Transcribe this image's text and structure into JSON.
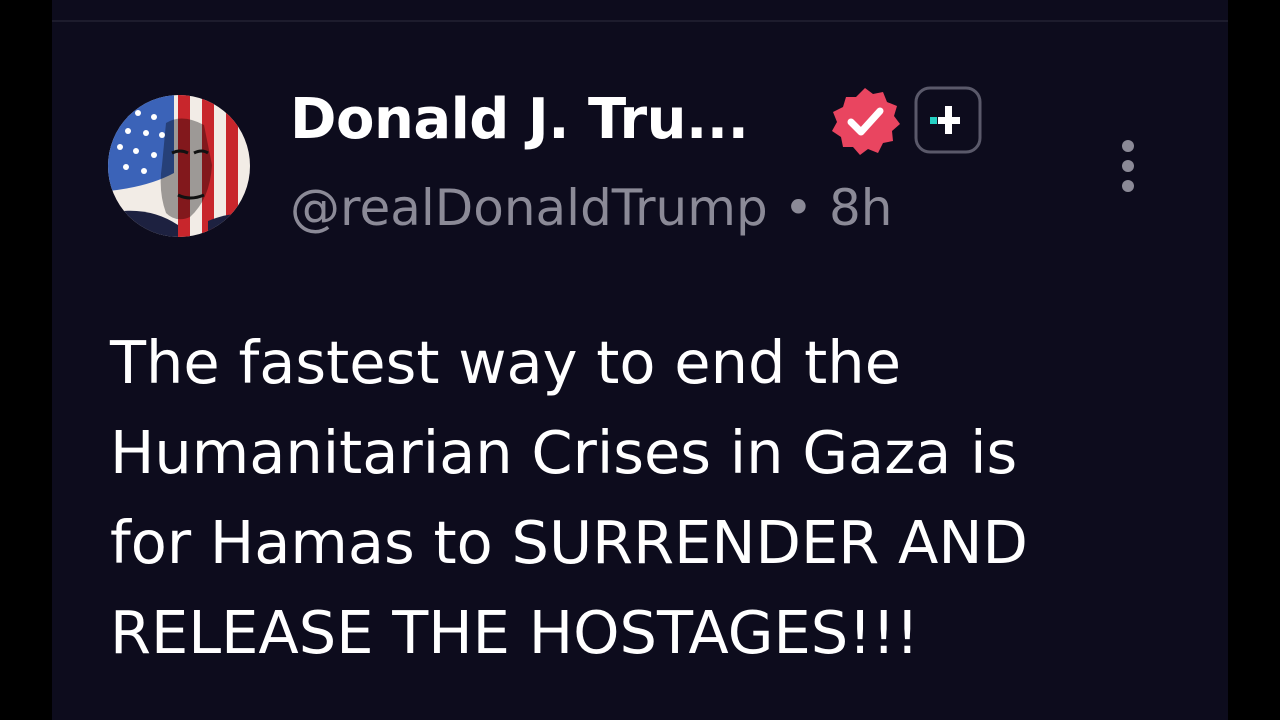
{
  "post": {
    "author": {
      "display_name": "Donald J. Tru...",
      "handle": "@realDonaldTrump",
      "separator": "•",
      "time_ago": "8h",
      "avatar_icon": "flag-portrait-avatar",
      "verified_icon": "verified-checkmark-icon",
      "verified_color": "#e94560",
      "plus_icon": "plus-subscription-icon",
      "plus_accent": "#25d0c3"
    },
    "menu_icon": "vertical-ellipsis-icon",
    "body_lines": [
      "The fastest way to end the",
      "Humanitarian Crises in Gaza is",
      "for Hamas to SURRENDER AND",
      "RELEASE THE HOSTAGES!!!"
    ]
  },
  "colors": {
    "background": "#0d0c1d",
    "text_primary": "#ffffff",
    "text_secondary": "#8b8a97"
  }
}
